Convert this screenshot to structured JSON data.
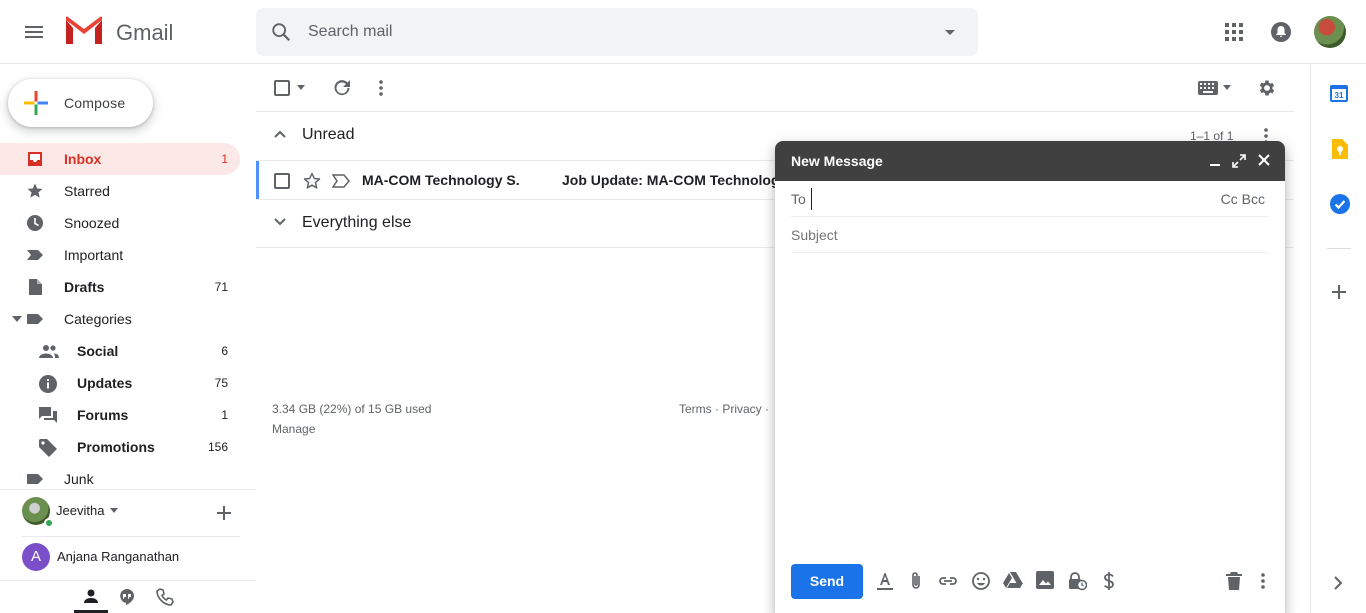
{
  "app": {
    "name": "Gmail"
  },
  "search": {
    "placeholder": "Search mail"
  },
  "compose_button": {
    "label": "Compose"
  },
  "nav": [
    {
      "label": "Inbox",
      "count": "1"
    },
    {
      "label": "Starred",
      "count": ""
    },
    {
      "label": "Snoozed",
      "count": ""
    },
    {
      "label": "Important",
      "count": ""
    },
    {
      "label": "Drafts",
      "count": "71"
    },
    {
      "label": "Categories",
      "count": ""
    },
    {
      "label": "Social",
      "count": "6"
    },
    {
      "label": "Updates",
      "count": "75"
    },
    {
      "label": "Forums",
      "count": "1"
    },
    {
      "label": "Promotions",
      "count": "156"
    },
    {
      "label": "Junk",
      "count": ""
    }
  ],
  "hangouts": {
    "user_name": "Jeevitha",
    "contact_initial": "A",
    "contact_name": "Anjana Ranganathan"
  },
  "sections": {
    "unread_label": "Unread",
    "unread_count": "1–1 of 1",
    "else_label": "Everything else"
  },
  "email_row": {
    "sender": "MA-COM Technology S.",
    "subject": "Job Update: MA-COM Technolog"
  },
  "footer": {
    "storage": "3.34 GB (22%) of 15 GB used",
    "manage": "Manage",
    "terms": "Terms · Privacy ·"
  },
  "compose_window": {
    "title": "New Message",
    "to_label": "To",
    "cc_bcc": "Cc Bcc",
    "subject_placeholder": "Subject",
    "send_label": "Send"
  },
  "colors": {
    "inbox_active_bg": "#fce8e6",
    "inbox_active_text": "#d93025",
    "send_button": "#1a73e8",
    "compose_header": "#404040"
  },
  "icons": [
    "menu-icon",
    "gmail-logo",
    "search-icon",
    "search-options-icon",
    "apps-icon",
    "notifications-icon",
    "refresh-icon",
    "more-icon",
    "keyboard-icon",
    "settings-icon",
    "calendar-icon",
    "keep-icon",
    "tasks-icon"
  ]
}
